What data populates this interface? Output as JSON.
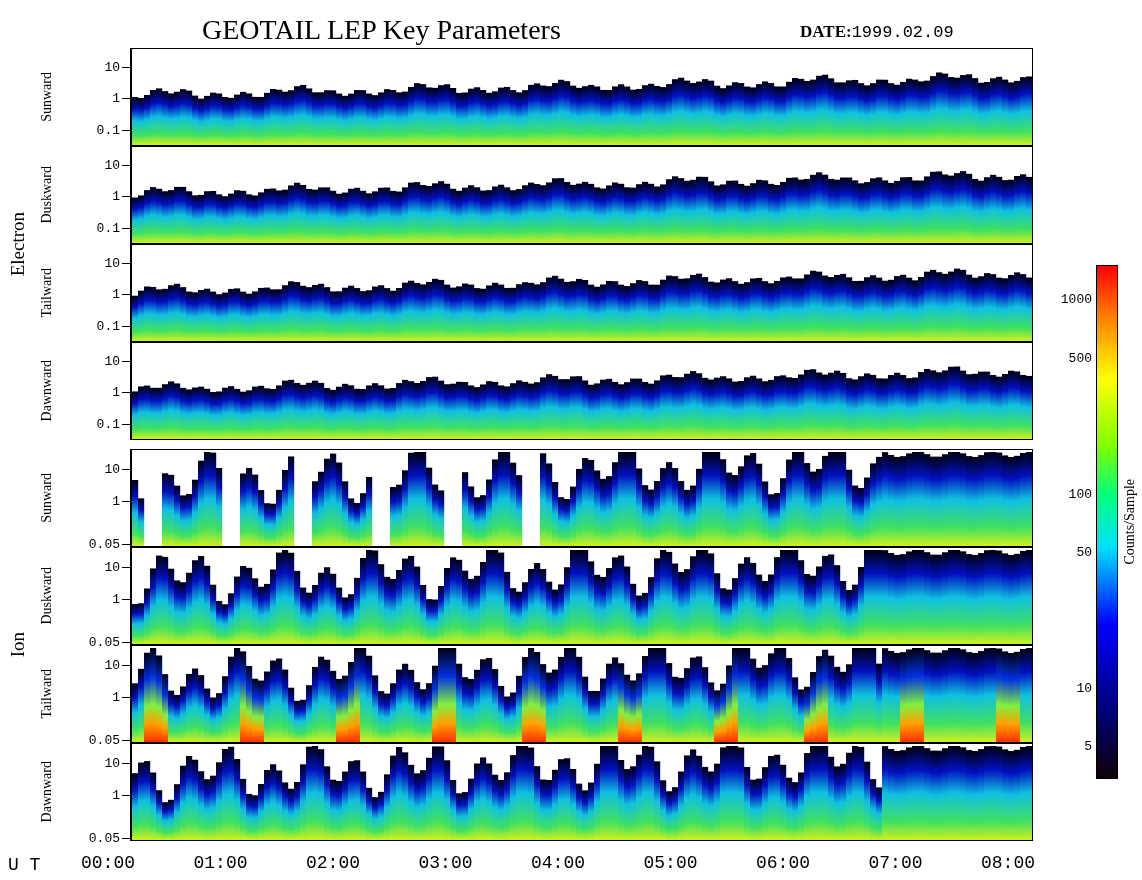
{
  "title": "GEOTAIL LEP Key Parameters",
  "date_label": "DATE:",
  "date": "1999.02.09",
  "groups": [
    {
      "name": "Electron",
      "kind": "electron",
      "panels": [
        {
          "direction": "Sunward",
          "yticks": [
            "10",
            "1",
            "0.1"
          ]
        },
        {
          "direction": "Duskward",
          "yticks": [
            "10",
            "1",
            "0.1"
          ]
        },
        {
          "direction": "Tailward",
          "yticks": [
            "10",
            "1",
            "0.1"
          ]
        },
        {
          "direction": "Dawnward",
          "yticks": [
            "10",
            "1",
            "0.1"
          ]
        }
      ]
    },
    {
      "name": "Ion",
      "kind": "ion",
      "panels": [
        {
          "direction": "Sunward",
          "yticks": [
            "10",
            "1",
            "0.05"
          ]
        },
        {
          "direction": "Duskward",
          "yticks": [
            "10",
            "1",
            "0.05"
          ]
        },
        {
          "direction": "Tailward",
          "yticks": [
            "10",
            "1",
            "0.05"
          ]
        },
        {
          "direction": "Dawnward",
          "yticks": [
            "10",
            "1",
            "0.05"
          ]
        }
      ]
    }
  ],
  "time_axis": {
    "label": "U T",
    "ticks": [
      "00:00",
      "01:00",
      "02:00",
      "03:00",
      "04:00",
      "05:00",
      "06:00",
      "07:00",
      "08:00"
    ]
  },
  "colorbar": {
    "label": "Counts/Sample",
    "ticks": [
      "1000",
      "500",
      "100",
      "50",
      "10",
      "5"
    ]
  }
}
